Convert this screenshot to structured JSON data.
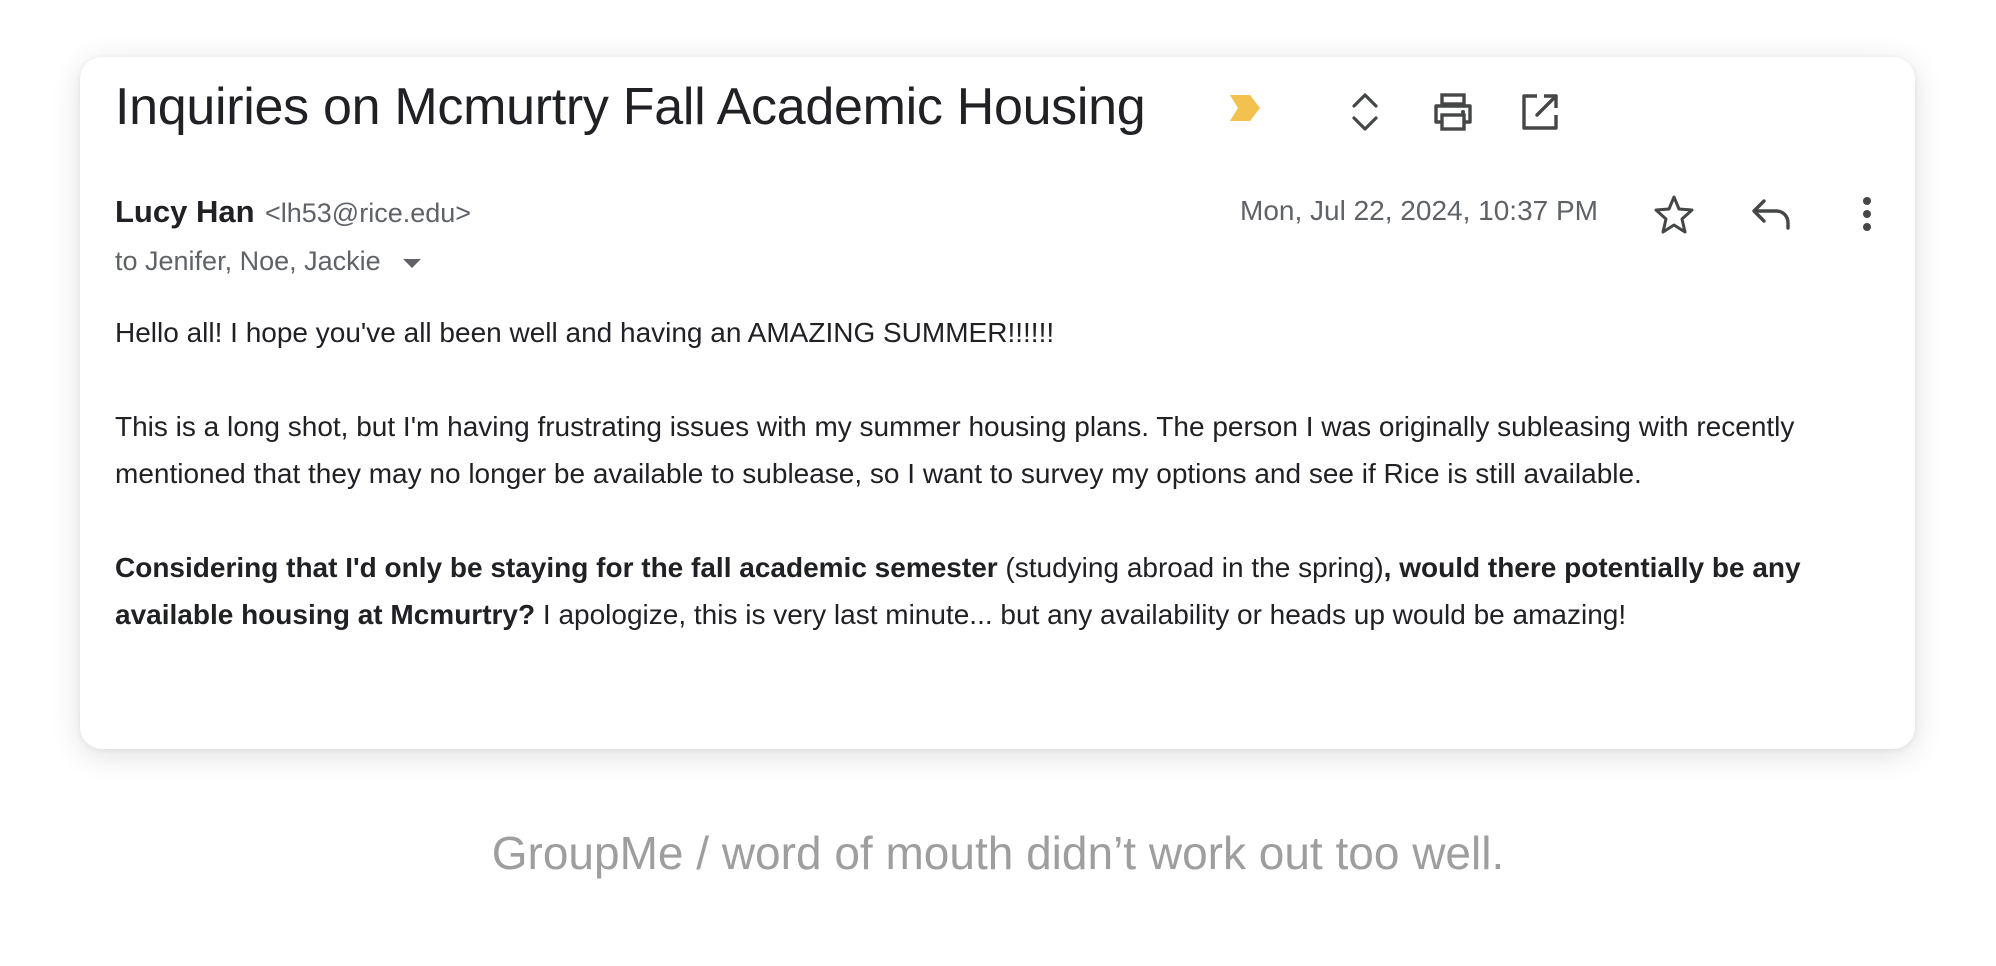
{
  "email": {
    "subject": "Inquiries on Mcmurtry Fall Academic Housing",
    "label_color": "#F2C14E",
    "toolbar": {
      "expand_icon": "unfold-icon",
      "print_icon": "print-icon",
      "open_new_window_icon": "open-in-new-icon"
    },
    "sender": {
      "name": "Lucy Han",
      "email": "<lh53@rice.edu>"
    },
    "recipients": "to Jenifer, Noe, Jackie",
    "date": "Mon, Jul 22, 2024, 10:37 PM",
    "actions": {
      "star_icon": "star-icon",
      "reply_icon": "reply-icon",
      "more_icon": "more-vertical-icon"
    },
    "body": {
      "p1": "Hello all! I hope you've all been well and having an AMAZING SUMMER!!!!!!",
      "p2": "This is a long shot, but I'm having frustrating issues with my summer housing plans. The person I was originally subleasing with recently mentioned that they may no longer be available to sublease, so I want to survey my options and see if Rice is still available.",
      "p3_bold1": "Considering that I'd only be staying for the fall academic semester",
      "p3_normal1": " (studying abroad in the spring)",
      "p3_bold2": ", would there potentially be any available housing at Mcmurtry?",
      "p3_normal2": " I apologize, this is very last minute... but any availability or heads up would be amazing!"
    }
  },
  "caption": "GroupMe / word of mouth didn’t work out too well."
}
